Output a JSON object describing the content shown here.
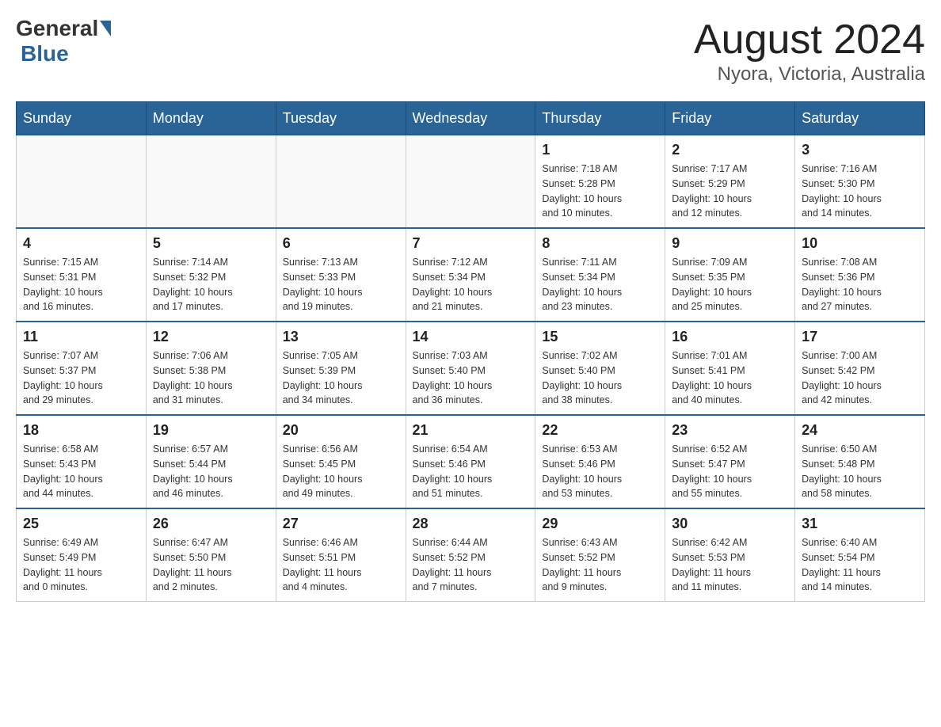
{
  "header": {
    "logo_general": "General",
    "logo_blue": "Blue",
    "month_title": "August 2024",
    "location": "Nyora, Victoria, Australia"
  },
  "weekdays": [
    "Sunday",
    "Monday",
    "Tuesday",
    "Wednesday",
    "Thursday",
    "Friday",
    "Saturday"
  ],
  "weeks": [
    [
      {
        "day": "",
        "info": ""
      },
      {
        "day": "",
        "info": ""
      },
      {
        "day": "",
        "info": ""
      },
      {
        "day": "",
        "info": ""
      },
      {
        "day": "1",
        "info": "Sunrise: 7:18 AM\nSunset: 5:28 PM\nDaylight: 10 hours\nand 10 minutes."
      },
      {
        "day": "2",
        "info": "Sunrise: 7:17 AM\nSunset: 5:29 PM\nDaylight: 10 hours\nand 12 minutes."
      },
      {
        "day": "3",
        "info": "Sunrise: 7:16 AM\nSunset: 5:30 PM\nDaylight: 10 hours\nand 14 minutes."
      }
    ],
    [
      {
        "day": "4",
        "info": "Sunrise: 7:15 AM\nSunset: 5:31 PM\nDaylight: 10 hours\nand 16 minutes."
      },
      {
        "day": "5",
        "info": "Sunrise: 7:14 AM\nSunset: 5:32 PM\nDaylight: 10 hours\nand 17 minutes."
      },
      {
        "day": "6",
        "info": "Sunrise: 7:13 AM\nSunset: 5:33 PM\nDaylight: 10 hours\nand 19 minutes."
      },
      {
        "day": "7",
        "info": "Sunrise: 7:12 AM\nSunset: 5:34 PM\nDaylight: 10 hours\nand 21 minutes."
      },
      {
        "day": "8",
        "info": "Sunrise: 7:11 AM\nSunset: 5:34 PM\nDaylight: 10 hours\nand 23 minutes."
      },
      {
        "day": "9",
        "info": "Sunrise: 7:09 AM\nSunset: 5:35 PM\nDaylight: 10 hours\nand 25 minutes."
      },
      {
        "day": "10",
        "info": "Sunrise: 7:08 AM\nSunset: 5:36 PM\nDaylight: 10 hours\nand 27 minutes."
      }
    ],
    [
      {
        "day": "11",
        "info": "Sunrise: 7:07 AM\nSunset: 5:37 PM\nDaylight: 10 hours\nand 29 minutes."
      },
      {
        "day": "12",
        "info": "Sunrise: 7:06 AM\nSunset: 5:38 PM\nDaylight: 10 hours\nand 31 minutes."
      },
      {
        "day": "13",
        "info": "Sunrise: 7:05 AM\nSunset: 5:39 PM\nDaylight: 10 hours\nand 34 minutes."
      },
      {
        "day": "14",
        "info": "Sunrise: 7:03 AM\nSunset: 5:40 PM\nDaylight: 10 hours\nand 36 minutes."
      },
      {
        "day": "15",
        "info": "Sunrise: 7:02 AM\nSunset: 5:40 PM\nDaylight: 10 hours\nand 38 minutes."
      },
      {
        "day": "16",
        "info": "Sunrise: 7:01 AM\nSunset: 5:41 PM\nDaylight: 10 hours\nand 40 minutes."
      },
      {
        "day": "17",
        "info": "Sunrise: 7:00 AM\nSunset: 5:42 PM\nDaylight: 10 hours\nand 42 minutes."
      }
    ],
    [
      {
        "day": "18",
        "info": "Sunrise: 6:58 AM\nSunset: 5:43 PM\nDaylight: 10 hours\nand 44 minutes."
      },
      {
        "day": "19",
        "info": "Sunrise: 6:57 AM\nSunset: 5:44 PM\nDaylight: 10 hours\nand 46 minutes."
      },
      {
        "day": "20",
        "info": "Sunrise: 6:56 AM\nSunset: 5:45 PM\nDaylight: 10 hours\nand 49 minutes."
      },
      {
        "day": "21",
        "info": "Sunrise: 6:54 AM\nSunset: 5:46 PM\nDaylight: 10 hours\nand 51 minutes."
      },
      {
        "day": "22",
        "info": "Sunrise: 6:53 AM\nSunset: 5:46 PM\nDaylight: 10 hours\nand 53 minutes."
      },
      {
        "day": "23",
        "info": "Sunrise: 6:52 AM\nSunset: 5:47 PM\nDaylight: 10 hours\nand 55 minutes."
      },
      {
        "day": "24",
        "info": "Sunrise: 6:50 AM\nSunset: 5:48 PM\nDaylight: 10 hours\nand 58 minutes."
      }
    ],
    [
      {
        "day": "25",
        "info": "Sunrise: 6:49 AM\nSunset: 5:49 PM\nDaylight: 11 hours\nand 0 minutes."
      },
      {
        "day": "26",
        "info": "Sunrise: 6:47 AM\nSunset: 5:50 PM\nDaylight: 11 hours\nand 2 minutes."
      },
      {
        "day": "27",
        "info": "Sunrise: 6:46 AM\nSunset: 5:51 PM\nDaylight: 11 hours\nand 4 minutes."
      },
      {
        "day": "28",
        "info": "Sunrise: 6:44 AM\nSunset: 5:52 PM\nDaylight: 11 hours\nand 7 minutes."
      },
      {
        "day": "29",
        "info": "Sunrise: 6:43 AM\nSunset: 5:52 PM\nDaylight: 11 hours\nand 9 minutes."
      },
      {
        "day": "30",
        "info": "Sunrise: 6:42 AM\nSunset: 5:53 PM\nDaylight: 11 hours\nand 11 minutes."
      },
      {
        "day": "31",
        "info": "Sunrise: 6:40 AM\nSunset: 5:54 PM\nDaylight: 11 hours\nand 14 minutes."
      }
    ]
  ]
}
